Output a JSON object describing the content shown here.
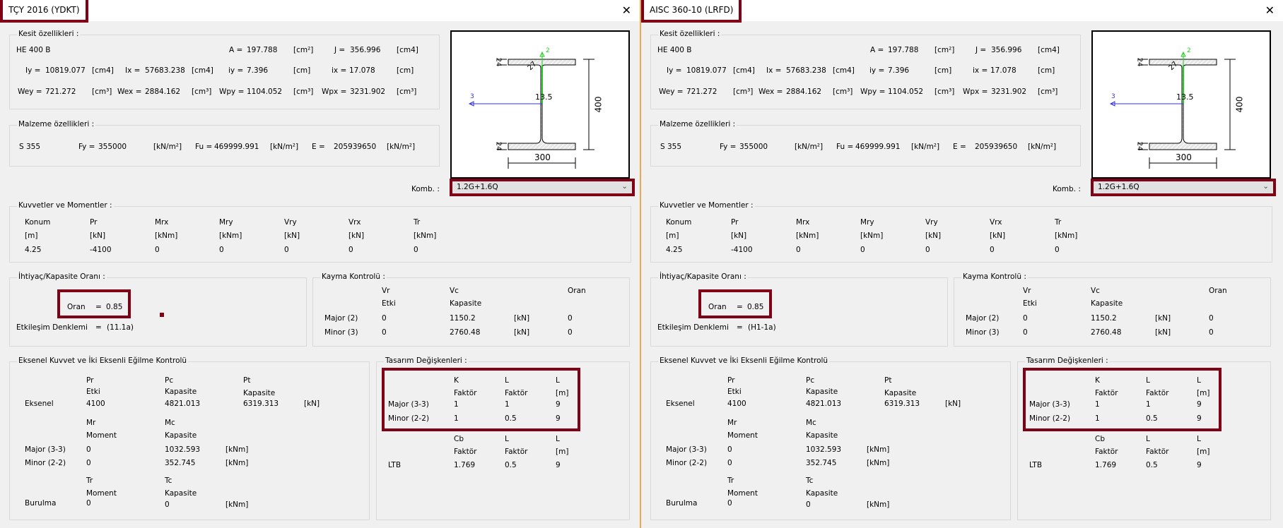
{
  "panels": [
    {
      "title": "TÇY 2016 (YDKT)",
      "equation": "(11.1a)"
    },
    {
      "title": "AISC 360-10 (LRFD)",
      "equation": "(H1-1a)"
    }
  ],
  "common": {
    "close": "✕",
    "kesit": {
      "legend": "Kesit özellikleri :",
      "name": "HE 400 B",
      "A": [
        "A =",
        "197.788",
        "[cm²]"
      ],
      "J": [
        "J =",
        "356.996",
        "[cm4]"
      ],
      "Iy": [
        "Iy =",
        "10819.077",
        "[cm4]"
      ],
      "Ix": [
        "Ix =",
        "57683.238",
        "[cm4]"
      ],
      "iy": [
        "iy =",
        "7.396",
        "[cm]"
      ],
      "ix": [
        "ix =",
        "17.078",
        "[cm]"
      ],
      "Wey": [
        "Wey =",
        "721.272",
        "[cm³]"
      ],
      "Wex": [
        "Wex =",
        "2884.162",
        "[cm³]"
      ],
      "Wpy": [
        "Wpy =",
        "1104.052",
        "[cm³]"
      ],
      "Wpx": [
        "Wpx =",
        "3231.902",
        "[cm³]"
      ]
    },
    "malzeme": {
      "legend": "Malzeme özellikleri :",
      "grade": "S 355",
      "Fy": [
        "Fy =",
        "355000",
        "[kN/m²]"
      ],
      "Fu": [
        "Fu =",
        "469999.991",
        "[kN/m²]"
      ],
      "E": [
        "E =",
        "205939650",
        "[kN/m²]"
      ]
    },
    "drawing": {
      "flange_t": "24",
      "web_t": "13.5",
      "height": "400",
      "width": "300",
      "r": "27",
      "axis2": "2",
      "axis3": "3"
    },
    "komb": {
      "label": "Komb. :",
      "value": "1.2G+1.6Q"
    },
    "kuvvet": {
      "legend": "Kuvvetler ve Momentler :",
      "headers": [
        "Konum",
        "Pr",
        "Mrx",
        "Mry",
        "Vry",
        "Vrx",
        "Tr"
      ],
      "units": [
        "[m]",
        "[kN]",
        "[kNm]",
        "[kNm]",
        "[kN]",
        "[kN]",
        "[kNm]"
      ],
      "values": [
        "4.25",
        "-4100",
        "0",
        "0",
        "0",
        "0",
        "0"
      ]
    },
    "ratio": {
      "legend": "İhtiyaç/Kapasite Oranı :",
      "oran_label": "Oran",
      "eq": "=",
      "oran": "0.85",
      "etk_label": "Etkileşim Denklemi"
    },
    "kayma": {
      "legend": "Kayma Kontrolü :",
      "h1": [
        "Vr",
        "Vc",
        "Oran"
      ],
      "h2": [
        "Etki",
        "Kapasite"
      ],
      "rows": [
        [
          "Major (2)",
          "0",
          "1150.2",
          "[kN]",
          "0"
        ],
        [
          "Minor (3)",
          "0",
          "2760.48",
          "[kN]",
          "0"
        ]
      ]
    },
    "eksenel": {
      "legend": "Eksenel Kuvvet ve İki Eksenli Eğilme Kontrolü",
      "h1": [
        "Pr",
        "Pc",
        "Pt"
      ],
      "h2": [
        "Etki",
        "Kapasite",
        "Kapasite"
      ],
      "row": [
        "Eksenel",
        "4100",
        "4821.013",
        "6319.313",
        "[kN]"
      ],
      "m1": [
        "Mr",
        "Mc"
      ],
      "m2": [
        "Moment",
        "Kapasite"
      ],
      "mrows": [
        [
          "Major (3-3)",
          "0",
          "1032.593",
          "[kNm]"
        ],
        [
          "Minor (2-2)",
          "0",
          "352.745",
          "[kNm]"
        ]
      ],
      "t1": [
        "Tr",
        "Tc"
      ],
      "t2": [
        "Moment",
        "Kapasite"
      ],
      "trow": [
        "Burulma",
        "0",
        "0",
        "[kNm]"
      ]
    },
    "tasarim": {
      "legend": "Tasarım Değişkenleri :",
      "h1": [
        "K",
        "L",
        "L"
      ],
      "h2": [
        "Faktör",
        "Faktör",
        "[m]"
      ],
      "rows": [
        [
          "Major (3-3)",
          "1",
          "1",
          "9"
        ],
        [
          "Minor (2-2)",
          "1",
          "0.5",
          "9"
        ]
      ],
      "l1": [
        "Cb",
        "L",
        "L"
      ],
      "l2": [
        "Faktör",
        "Faktör",
        "[m]"
      ],
      "ltb": [
        "LTB",
        "1.769",
        "0.5",
        "9"
      ]
    }
  }
}
